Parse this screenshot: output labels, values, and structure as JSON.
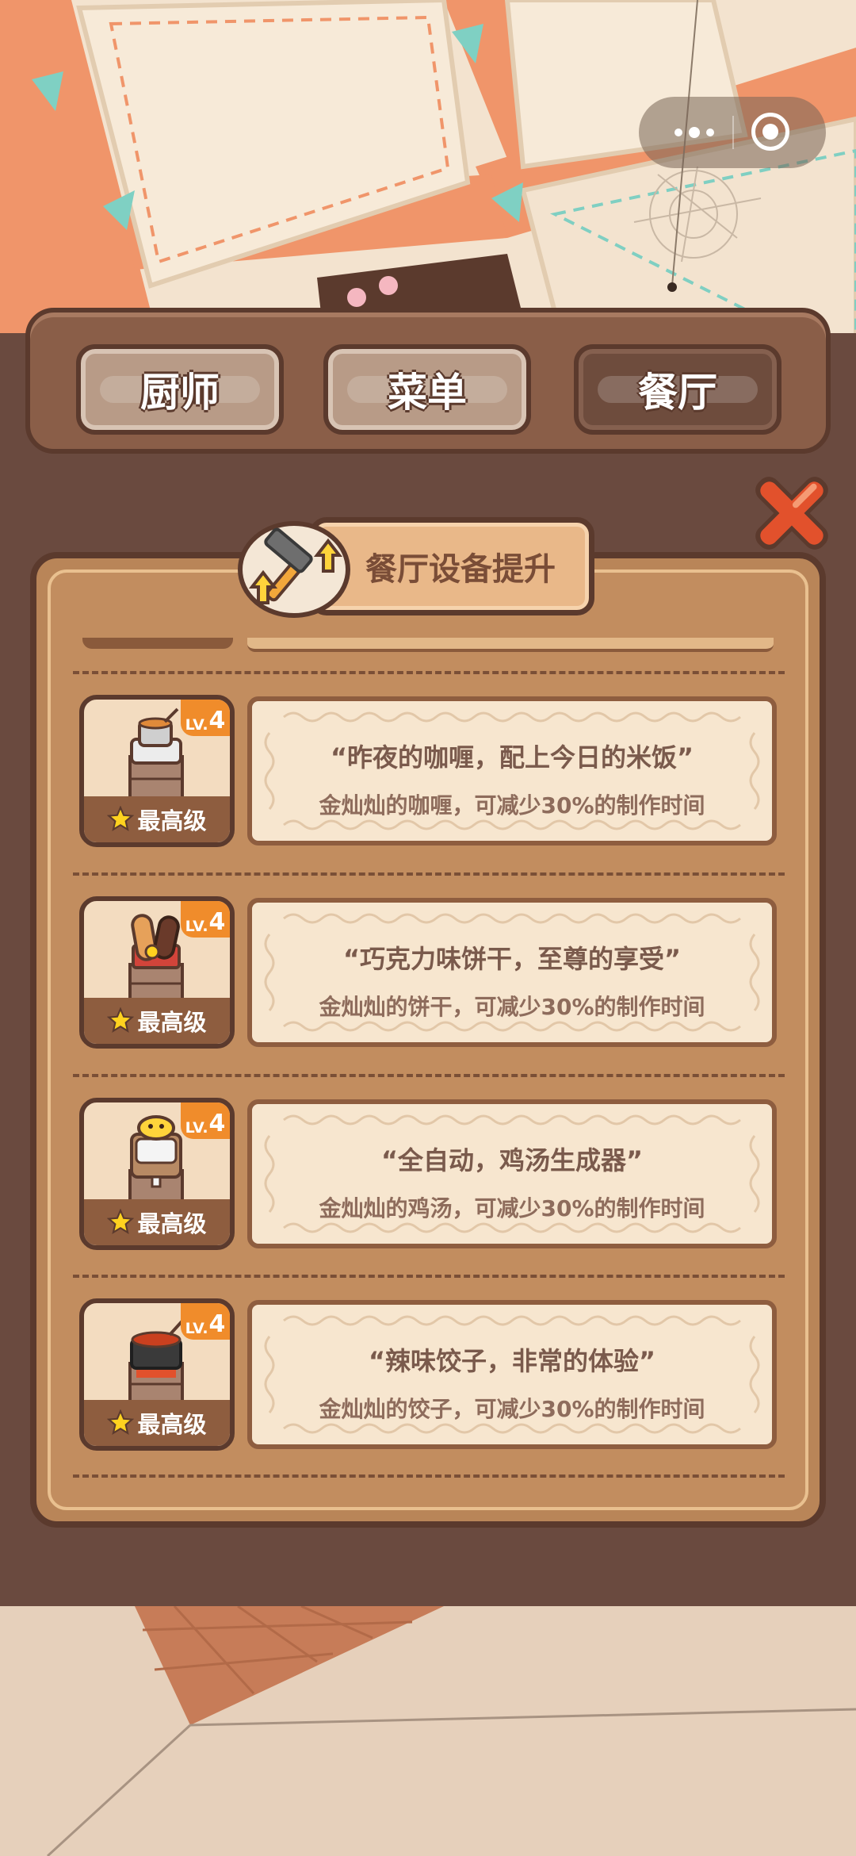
{
  "tabs": [
    {
      "label": "厨师",
      "active": false
    },
    {
      "label": "菜单",
      "active": false
    },
    {
      "label": "餐厅",
      "active": true
    }
  ],
  "panel": {
    "title": "餐厅设备提升"
  },
  "items": [
    {
      "icon": "curry-pot-icon",
      "level_prefix": "LV.",
      "level": "4",
      "status": "最高级",
      "quote": "“昨夜的咖喱，配上今日的米饭”",
      "effect": "金灿灿的咖喱，可减少30%的制作时间"
    },
    {
      "icon": "biscuit-icon",
      "level_prefix": "LV.",
      "level": "4",
      "status": "最高级",
      "quote": "“巧克力味饼干，至尊的享受”",
      "effect": "金灿灿的饼干，可减少30%的制作时间"
    },
    {
      "icon": "soup-machine-icon",
      "level_prefix": "LV.",
      "level": "4",
      "status": "最高级",
      "quote": "“全自动，鸡汤生成器”",
      "effect": "金灿灿的鸡汤，可减少30%的制作时间"
    },
    {
      "icon": "dumpling-pot-icon",
      "level_prefix": "LV.",
      "level": "4",
      "status": "最高级",
      "quote": "“辣味饺子，非常的体验”",
      "effect": "金灿灿的饺子，可减少30%的制作时间"
    }
  ],
  "colors": {
    "accent": "#f08c2b",
    "wood": "#8e5d3f",
    "close": "#e2512c"
  }
}
